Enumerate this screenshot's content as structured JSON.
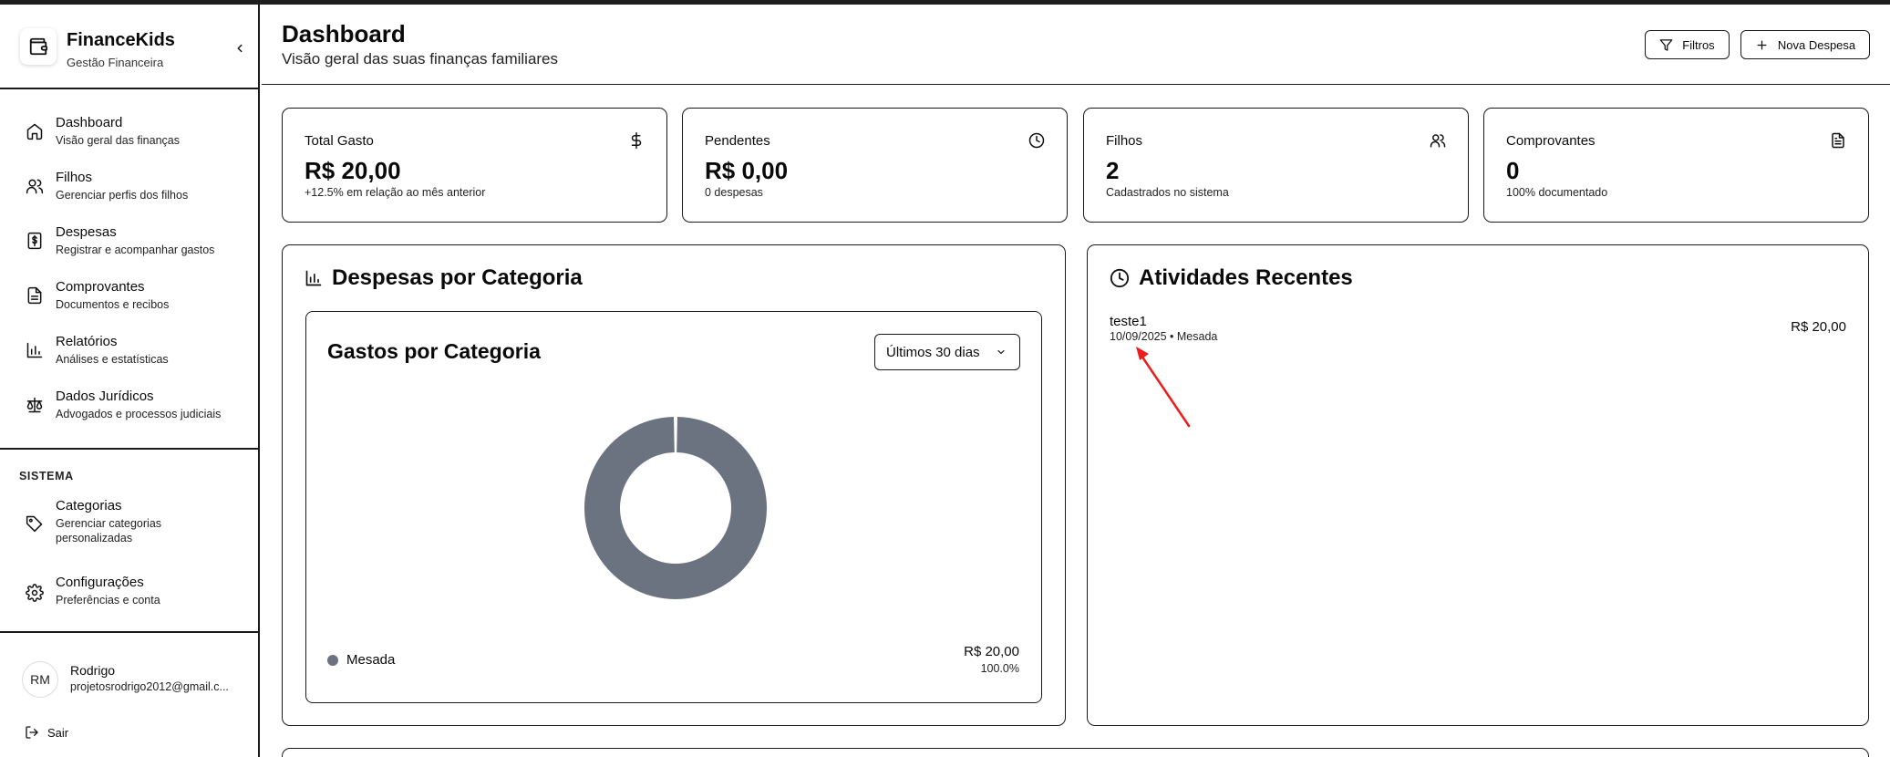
{
  "brand": {
    "title": "FinanceKids",
    "subtitle": "Gestão Financeira"
  },
  "nav": [
    {
      "label": "Dashboard",
      "sub": "Visão geral das finanças",
      "icon": "home-icon"
    },
    {
      "label": "Filhos",
      "sub": "Gerenciar perfis dos filhos",
      "icon": "users-icon"
    },
    {
      "label": "Despesas",
      "sub": "Registrar e acompanhar gastos",
      "icon": "dollar-receipt-icon"
    },
    {
      "label": "Comprovantes",
      "sub": "Documentos e recibos",
      "icon": "file-icon"
    },
    {
      "label": "Relatórios",
      "sub": "Análises e estatísticas",
      "icon": "bar-chart-icon"
    },
    {
      "label": "Dados Jurídicos",
      "sub": "Advogados e processos judiciais",
      "icon": "scale-icon"
    }
  ],
  "system": {
    "title": "SISTEMA",
    "items": [
      {
        "label": "Categorias",
        "sub": "Gerenciar categorias personalizadas",
        "icon": "tag-icon"
      },
      {
        "label": "Configurações",
        "sub": "Preferências e conta",
        "icon": "gear-icon"
      }
    ]
  },
  "user": {
    "initials": "RM",
    "name": "Rodrigo",
    "email": "projetosrodrigo2012@gmail.c...",
    "logout": "Sair"
  },
  "header": {
    "title": "Dashboard",
    "subtitle": "Visão geral das suas finanças familiares",
    "filters_label": "Filtros",
    "new_expense_label": "Nova Despesa"
  },
  "stats": [
    {
      "title": "Total Gasto",
      "value": "R$ 20,00",
      "note": "+12.5% em relação ao mês anterior",
      "icon": "dollar-icon"
    },
    {
      "title": "Pendentes",
      "value": "R$ 0,00",
      "note": "0 despesas",
      "icon": "clock-icon"
    },
    {
      "title": "Filhos",
      "value": "2",
      "note": "Cadastrados no sistema",
      "icon": "users-icon"
    },
    {
      "title": "Comprovantes",
      "value": "0",
      "note": "100% documentado",
      "icon": "file-text-icon"
    }
  ],
  "category_panel": {
    "title": "Despesas por Categoria",
    "chart_title": "Gastos por Categoria",
    "period": "Últimos 30 dias",
    "legend": [
      {
        "name": "Mesada",
        "value": "R$ 20,00",
        "percent": "100.0%"
      }
    ]
  },
  "chart_data": {
    "type": "pie",
    "title": "Gastos por Categoria",
    "categories": [
      "Mesada"
    ],
    "values": [
      20.0
    ],
    "colors": [
      "#6b7280"
    ]
  },
  "activities": {
    "title": "Atividades Recentes",
    "items": [
      {
        "name": "teste1",
        "meta": "10/09/2025 • Mesada",
        "amount": "R$ 20,00"
      }
    ]
  }
}
